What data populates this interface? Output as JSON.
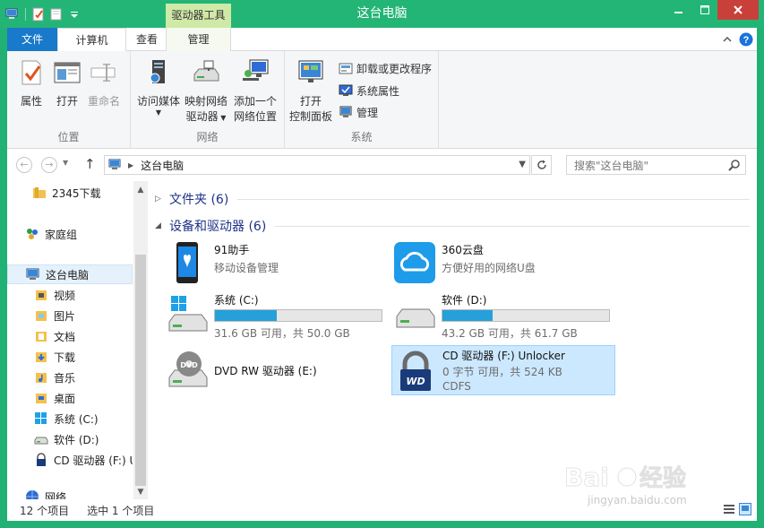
{
  "window": {
    "title": "这台电脑",
    "context_tab_header": "驱动器工具"
  },
  "ribbon_tabs": [
    "文件",
    "计算机",
    "查看",
    "管理"
  ],
  "ribbon": {
    "groups": {
      "location": {
        "label": "位置",
        "buttons": [
          "属性",
          "打开",
          "重命名"
        ]
      },
      "network": {
        "label": "网络",
        "access_media": [
          "访问媒体"
        ],
        "map_drive": [
          "映射网络",
          "驱动器"
        ],
        "add_location": [
          "添加一个",
          "网络位置"
        ]
      },
      "system": {
        "label": "系统",
        "open_cp": [
          "打开",
          "控制面板"
        ],
        "small": [
          "卸载或更改程序",
          "系统属性",
          "管理"
        ]
      }
    }
  },
  "address": {
    "crumb": "这台电脑",
    "search_placeholder": "搜索\"这台电脑\""
  },
  "nav": {
    "items": [
      {
        "label": "2345下载",
        "icon": "folder-icon"
      },
      {
        "label": "家庭组",
        "icon": "homegroup-icon"
      },
      {
        "label": "这台电脑",
        "icon": "computer-icon"
      },
      {
        "label": "视频",
        "icon": "videos-folder-icon"
      },
      {
        "label": "图片",
        "icon": "pictures-folder-icon"
      },
      {
        "label": "文档",
        "icon": "documents-folder-icon"
      },
      {
        "label": "下载",
        "icon": "downloads-folder-icon"
      },
      {
        "label": "音乐",
        "icon": "music-folder-icon"
      },
      {
        "label": "桌面",
        "icon": "desktop-folder-icon"
      },
      {
        "label": "系统 (C:)",
        "icon": "windows-drive-icon"
      },
      {
        "label": "软件 (D:)",
        "icon": "drive-icon"
      },
      {
        "label": "CD 驱动器 (F:) U",
        "icon": "cd-lock-icon"
      },
      {
        "label": "网络",
        "icon": "network-icon"
      }
    ]
  },
  "content": {
    "folders_header": "文件夹 (6)",
    "devices_header": "设备和驱动器 (6)",
    "tiles": [
      {
        "name": "91助手",
        "sub": "移动设备管理"
      },
      {
        "name": "360云盘",
        "sub": "方便好用的网络U盘"
      },
      {
        "name": "系统 (C:)",
        "sub": "31.6 GB 可用，共 50.0 GB",
        "used_fraction": 0.37
      },
      {
        "name": "软件 (D:)",
        "sub": "43.2 GB 可用，共 61.7 GB",
        "used_fraction": 0.3
      },
      {
        "name": "DVD RW 驱动器 (E:)"
      },
      {
        "name": "CD 驱动器 (F:) Unlocker",
        "sub": "0 字节 可用，共 524 KB",
        "sub2": "CDFS"
      }
    ]
  },
  "status": {
    "item_count": "12 个项目",
    "selected": "选中 1 个项目"
  },
  "colors": {
    "title_bar": "#23b576",
    "file_tab": "#1979ca",
    "context_tab": "#cfe9a7",
    "selection": "#cce8ff",
    "bar_fill": "#26a0da",
    "close_button": "#c9403a"
  }
}
